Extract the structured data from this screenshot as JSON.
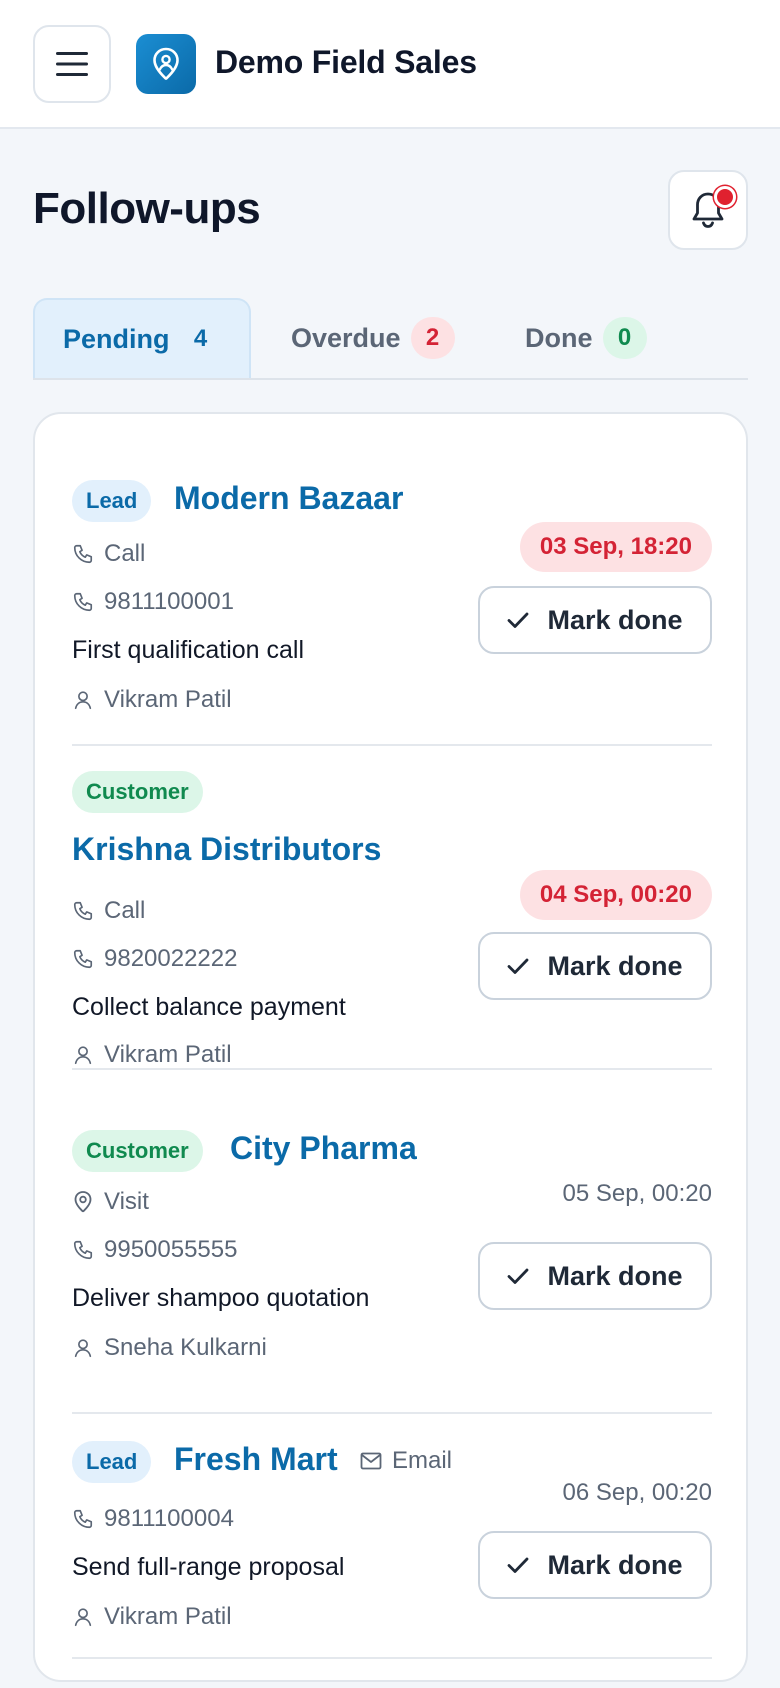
{
  "app": {
    "name": "Demo Field Sales"
  },
  "page": {
    "title": "Follow-ups"
  },
  "tabs": [
    {
      "label": "Pending",
      "count": "4"
    },
    {
      "label": "Overdue",
      "count": "2"
    },
    {
      "label": "Done",
      "count": "0"
    }
  ],
  "followups": [
    {
      "type_badge": "Lead",
      "name": "Modern Bazaar",
      "channel": "Call",
      "phone": "9811100001",
      "note": "First qualification call",
      "assignee": "Vikram Patil",
      "due": "03 Sep, 18:20",
      "action": "Mark done"
    },
    {
      "type_badge": "Customer",
      "name": "Krishna Distributors",
      "channel": "Call",
      "phone": "9820022222",
      "note": "Collect balance payment",
      "assignee": "Vikram Patil",
      "due": "04 Sep, 00:20",
      "action": "Mark done"
    },
    {
      "type_badge": "Customer",
      "name": "City Pharma",
      "channel": "Visit",
      "phone": "9950055555",
      "note": "Deliver shampoo quotation",
      "assignee": "Sneha Kulkarni",
      "due": "05 Sep, 00:20",
      "action": "Mark done"
    },
    {
      "type_badge": "Lead",
      "name": "Fresh Mart",
      "channel": "Email",
      "phone": "9811100004",
      "note": "Send full-range proposal",
      "assignee": "Vikram Patil",
      "due": "06 Sep, 00:20",
      "action": "Mark done"
    }
  ],
  "colors": {
    "brand": "#0b6aa8",
    "overdue_text": "#d42335",
    "overdue_bg": "#fde1e3",
    "customer_green": "#108a4f",
    "notification_dot": "#e0212f"
  },
  "icons": [
    "menu-icon",
    "location-pin-icon",
    "bell-icon",
    "phone-icon",
    "map-pin-icon",
    "mail-icon",
    "user-icon",
    "check-icon"
  ]
}
